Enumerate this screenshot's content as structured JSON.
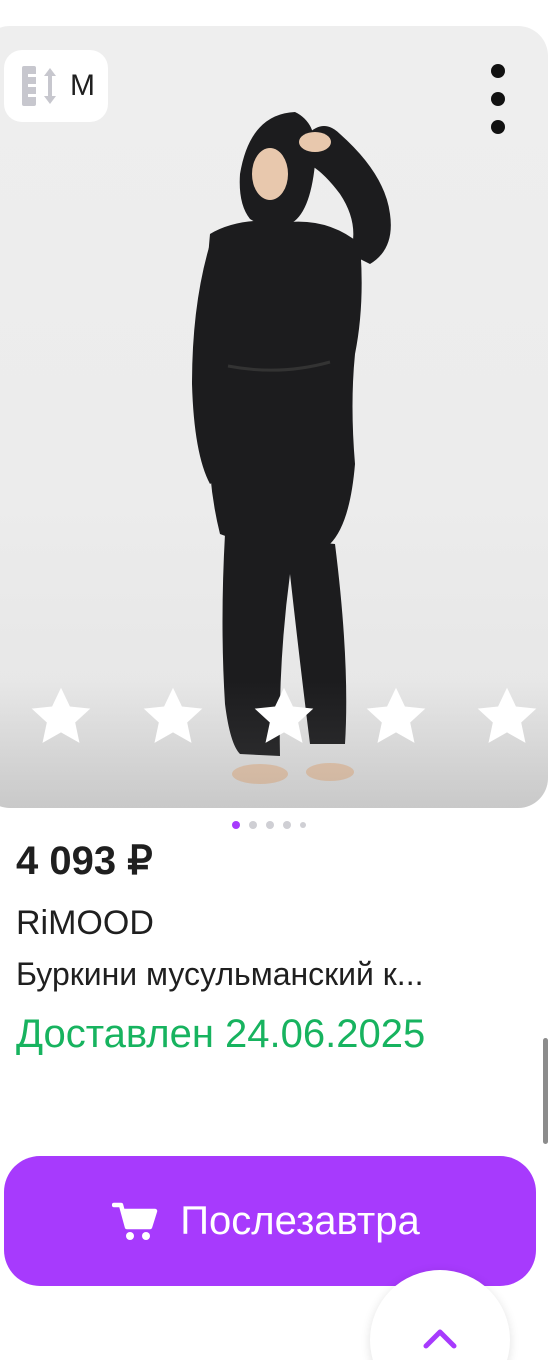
{
  "product": {
    "size_badge": {
      "icon": "size-ruler-icon",
      "size": "M"
    },
    "image": {
      "description_icon": "product-photo",
      "active_image_index": 1,
      "image_count": 5
    },
    "rating_stars": {
      "count": 5,
      "icon": "star-icon"
    },
    "price": "4 093 ₽",
    "brand": "RiMOOD",
    "title": "Буркини мусульманский к...",
    "delivery_status": "Доставлен 24.06.2025"
  },
  "actions": {
    "cart_button_label": "Послезавтра",
    "cart_icon": "cart-icon",
    "more_icon": "more-vertical-icon",
    "scroll_top_icon": "chevron-up-icon"
  },
  "colors": {
    "accent": "#a73afd",
    "delivery_green": "#17b35f",
    "text": "#1f1f1f"
  }
}
